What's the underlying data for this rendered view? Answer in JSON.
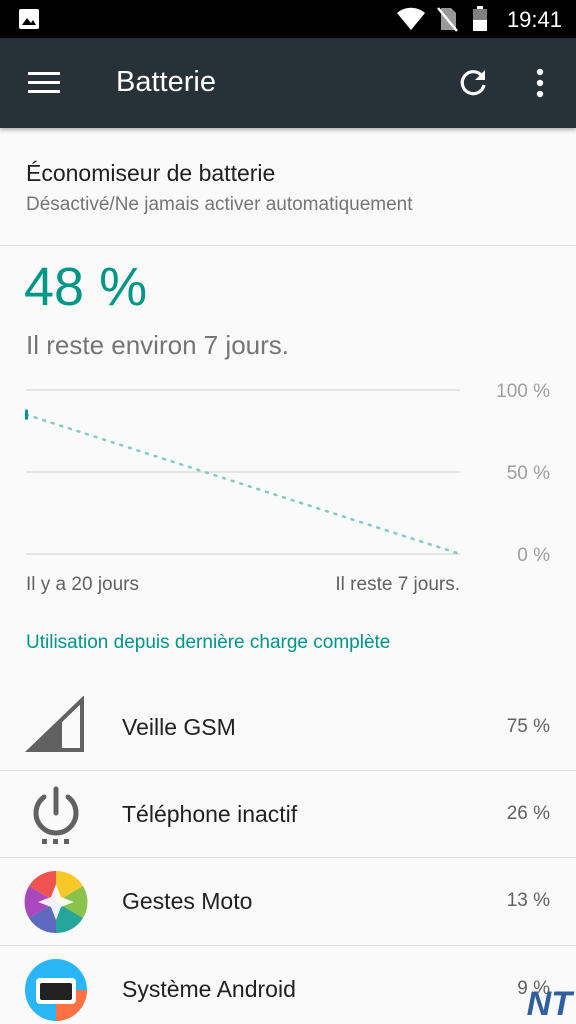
{
  "status_bar": {
    "time": "19:41",
    "icons": [
      "image-icon",
      "wifi-icon",
      "no-sim-icon",
      "battery-icon"
    ]
  },
  "app_bar": {
    "title": "Batterie",
    "icons": [
      "menu-icon",
      "refresh-icon",
      "more-vert-icon"
    ]
  },
  "battery_saver": {
    "title": "Économiseur de batterie",
    "subtitle": "Désactivé/Ne jamais activer automatiquement"
  },
  "battery": {
    "percent": "48 %",
    "remaining": "Il reste environ 7 jours."
  },
  "chart_data": {
    "type": "line",
    "ylabels": [
      "100 %",
      "50 %",
      "0 %"
    ],
    "ylim": [
      0,
      100
    ],
    "x_start_label": "Il y a 20 jours",
    "x_end_label": "Il reste 7 jours.",
    "history_point": {
      "x": 0,
      "y": 85
    },
    "projection": {
      "x": [
        0,
        1
      ],
      "y": [
        85,
        0
      ]
    },
    "grid": true,
    "color": "#80cbc4"
  },
  "usage": {
    "header": "Utilisation depuis dernière charge complète",
    "items": [
      {
        "name": "Veille GSM",
        "percent": "75 %",
        "icon": "signal-icon"
      },
      {
        "name": "Téléphone inactif",
        "percent": "26 %",
        "icon": "power-icon"
      },
      {
        "name": "Gestes Moto",
        "percent": "13 %",
        "icon": "moto-gestures-icon"
      },
      {
        "name": "Système Android",
        "percent": "9 %",
        "icon": "android-system-icon"
      }
    ]
  },
  "watermark": "NT",
  "colors": {
    "accent": "#009688",
    "app_bar": "#263238",
    "status_bar": "#000000"
  }
}
